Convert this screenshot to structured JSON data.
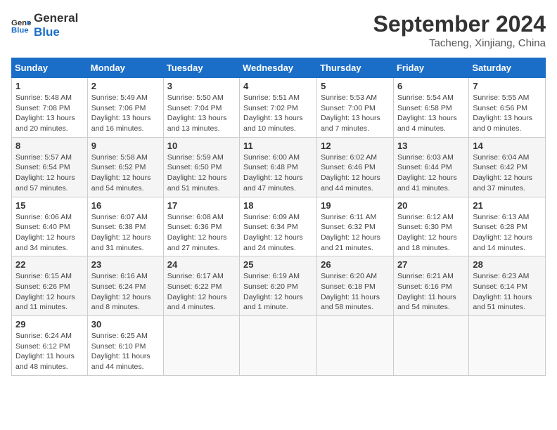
{
  "header": {
    "logo_line1": "General",
    "logo_line2": "Blue",
    "month": "September 2024",
    "location": "Tacheng, Xinjiang, China"
  },
  "weekdays": [
    "Sunday",
    "Monday",
    "Tuesday",
    "Wednesday",
    "Thursday",
    "Friday",
    "Saturday"
  ],
  "weeks": [
    [
      {
        "day": "1",
        "sunrise": "5:48 AM",
        "sunset": "7:08 PM",
        "daylight": "13 hours and 20 minutes."
      },
      {
        "day": "2",
        "sunrise": "5:49 AM",
        "sunset": "7:06 PM",
        "daylight": "13 hours and 16 minutes."
      },
      {
        "day": "3",
        "sunrise": "5:50 AM",
        "sunset": "7:04 PM",
        "daylight": "13 hours and 13 minutes."
      },
      {
        "day": "4",
        "sunrise": "5:51 AM",
        "sunset": "7:02 PM",
        "daylight": "13 hours and 10 minutes."
      },
      {
        "day": "5",
        "sunrise": "5:53 AM",
        "sunset": "7:00 PM",
        "daylight": "13 hours and 7 minutes."
      },
      {
        "day": "6",
        "sunrise": "5:54 AM",
        "sunset": "6:58 PM",
        "daylight": "13 hours and 4 minutes."
      },
      {
        "day": "7",
        "sunrise": "5:55 AM",
        "sunset": "6:56 PM",
        "daylight": "13 hours and 0 minutes."
      }
    ],
    [
      {
        "day": "8",
        "sunrise": "5:57 AM",
        "sunset": "6:54 PM",
        "daylight": "12 hours and 57 minutes."
      },
      {
        "day": "9",
        "sunrise": "5:58 AM",
        "sunset": "6:52 PM",
        "daylight": "12 hours and 54 minutes."
      },
      {
        "day": "10",
        "sunrise": "5:59 AM",
        "sunset": "6:50 PM",
        "daylight": "12 hours and 51 minutes."
      },
      {
        "day": "11",
        "sunrise": "6:00 AM",
        "sunset": "6:48 PM",
        "daylight": "12 hours and 47 minutes."
      },
      {
        "day": "12",
        "sunrise": "6:02 AM",
        "sunset": "6:46 PM",
        "daylight": "12 hours and 44 minutes."
      },
      {
        "day": "13",
        "sunrise": "6:03 AM",
        "sunset": "6:44 PM",
        "daylight": "12 hours and 41 minutes."
      },
      {
        "day": "14",
        "sunrise": "6:04 AM",
        "sunset": "6:42 PM",
        "daylight": "12 hours and 37 minutes."
      }
    ],
    [
      {
        "day": "15",
        "sunrise": "6:06 AM",
        "sunset": "6:40 PM",
        "daylight": "12 hours and 34 minutes."
      },
      {
        "day": "16",
        "sunrise": "6:07 AM",
        "sunset": "6:38 PM",
        "daylight": "12 hours and 31 minutes."
      },
      {
        "day": "17",
        "sunrise": "6:08 AM",
        "sunset": "6:36 PM",
        "daylight": "12 hours and 27 minutes."
      },
      {
        "day": "18",
        "sunrise": "6:09 AM",
        "sunset": "6:34 PM",
        "daylight": "12 hours and 24 minutes."
      },
      {
        "day": "19",
        "sunrise": "6:11 AM",
        "sunset": "6:32 PM",
        "daylight": "12 hours and 21 minutes."
      },
      {
        "day": "20",
        "sunrise": "6:12 AM",
        "sunset": "6:30 PM",
        "daylight": "12 hours and 18 minutes."
      },
      {
        "day": "21",
        "sunrise": "6:13 AM",
        "sunset": "6:28 PM",
        "daylight": "12 hours and 14 minutes."
      }
    ],
    [
      {
        "day": "22",
        "sunrise": "6:15 AM",
        "sunset": "6:26 PM",
        "daylight": "12 hours and 11 minutes."
      },
      {
        "day": "23",
        "sunrise": "6:16 AM",
        "sunset": "6:24 PM",
        "daylight": "12 hours and 8 minutes."
      },
      {
        "day": "24",
        "sunrise": "6:17 AM",
        "sunset": "6:22 PM",
        "daylight": "12 hours and 4 minutes."
      },
      {
        "day": "25",
        "sunrise": "6:19 AM",
        "sunset": "6:20 PM",
        "daylight": "12 hours and 1 minute."
      },
      {
        "day": "26",
        "sunrise": "6:20 AM",
        "sunset": "6:18 PM",
        "daylight": "11 hours and 58 minutes."
      },
      {
        "day": "27",
        "sunrise": "6:21 AM",
        "sunset": "6:16 PM",
        "daylight": "11 hours and 54 minutes."
      },
      {
        "day": "28",
        "sunrise": "6:23 AM",
        "sunset": "6:14 PM",
        "daylight": "11 hours and 51 minutes."
      }
    ],
    [
      {
        "day": "29",
        "sunrise": "6:24 AM",
        "sunset": "6:12 PM",
        "daylight": "11 hours and 48 minutes."
      },
      {
        "day": "30",
        "sunrise": "6:25 AM",
        "sunset": "6:10 PM",
        "daylight": "11 hours and 44 minutes."
      },
      null,
      null,
      null,
      null,
      null
    ]
  ]
}
